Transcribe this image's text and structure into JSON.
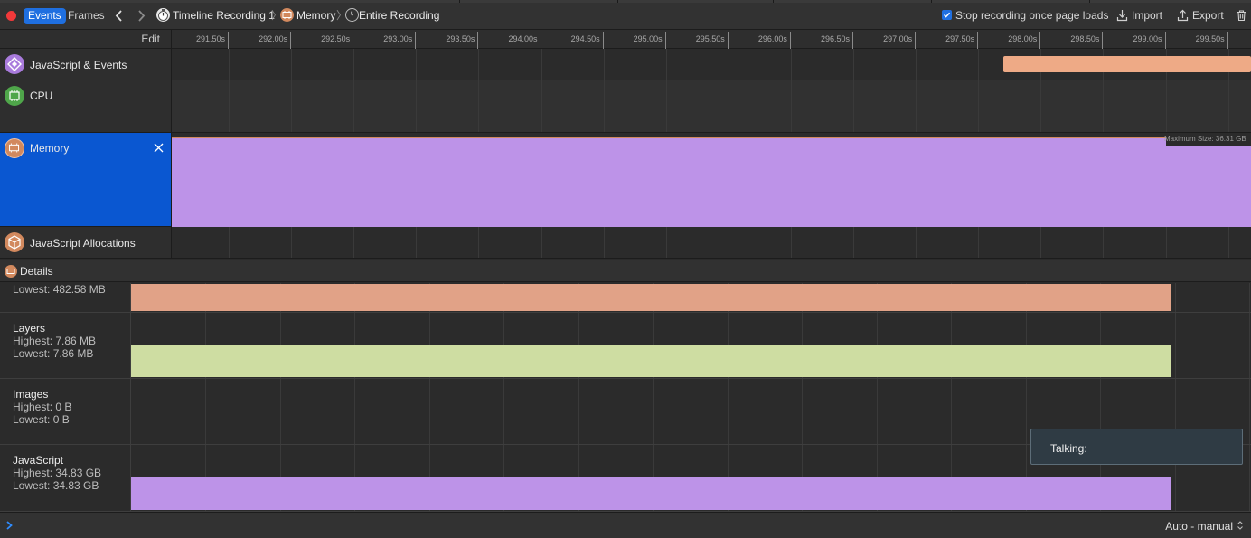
{
  "toolbar": {
    "tabs": [
      {
        "label": "Events",
        "active": true
      },
      {
        "label": "Frames",
        "active": false
      }
    ],
    "breadcrumbs": [
      "Timeline Recording 1",
      "Memory",
      "Entire Recording"
    ],
    "stop_recording_label": "Stop recording once page loads",
    "stop_recording_checked": true,
    "import_label": "Import",
    "export_label": "Export"
  },
  "ruler": {
    "edit_label": "Edit",
    "ticks": [
      "291.50s",
      "292.00s",
      "292.50s",
      "293.00s",
      "293.50s",
      "294.00s",
      "294.50s",
      "295.00s",
      "295.50s",
      "296.00s",
      "296.50s",
      "297.00s",
      "297.50s",
      "298.00s",
      "298.50s",
      "299.00s",
      "299.50s"
    ]
  },
  "tracks": [
    {
      "label": "JavaScript & Events",
      "icon": "javascript-events-icon",
      "color": "#a97bdc"
    },
    {
      "label": "CPU",
      "icon": "cpu-icon",
      "color": "#4fa64a"
    },
    {
      "label": "Memory",
      "icon": "memory-icon",
      "color": "#d2895e",
      "selected": true
    },
    {
      "label": "JavaScript Allocations",
      "icon": "javascript-allocations-icon",
      "color": "#d2895e"
    }
  ],
  "memory_lane": {
    "max_size_label": "Maximum Size: 36.31 GB"
  },
  "details": {
    "label": "Details",
    "rows": [
      {
        "name": "",
        "highest": "",
        "lowest": "Lowest: 482.58 MB",
        "color": "#e1a287"
      },
      {
        "name": "Layers",
        "highest": "Highest: 7.86 MB",
        "lowest": "Lowest: 7.86 MB",
        "color": "#cedda2"
      },
      {
        "name": "Images",
        "highest": "Highest: 0 B",
        "lowest": "Lowest: 0 B",
        "color": ""
      },
      {
        "name": "JavaScript",
        "highest": "Highest: 34.83 GB",
        "lowest": "Lowest: 34.83 GB",
        "color": "#bd93e8"
      }
    ]
  },
  "tooltip": {
    "text": "Talking:"
  },
  "bottombar": {
    "mode_label": "Auto - manual"
  },
  "colors": {
    "accent": "#1f6fe0",
    "selected_track": "#0a57d1",
    "record": "#f2393a",
    "js_events_bar": "#eeaa86",
    "memory_fill": "#bd93e8"
  }
}
